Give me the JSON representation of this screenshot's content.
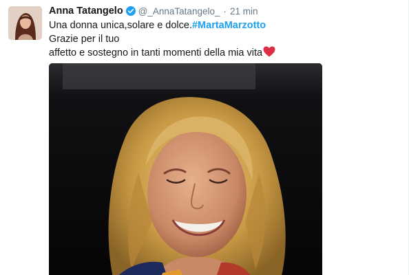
{
  "tweet": {
    "author_name": "Anna Tatangelo",
    "author_handle": "@_AnnaTatangelo_",
    "separator": "·",
    "timestamp": "21 min",
    "line1_text": "Una donna unica,solare e dolce.",
    "hashtag": "#MartaMarzotto",
    "line2_text": "Grazie per il tuo",
    "line3_text": "affetto e sostegno in tanti momenti della mia vita",
    "emoji": "red-heart"
  },
  "icons": {
    "verified": "verified-badge-icon",
    "heart": "red-heart-icon"
  },
  "colors": {
    "link": "#1da1f2",
    "text": "#14171a",
    "secondary_text": "#657786",
    "heart": "#dd2e44"
  }
}
